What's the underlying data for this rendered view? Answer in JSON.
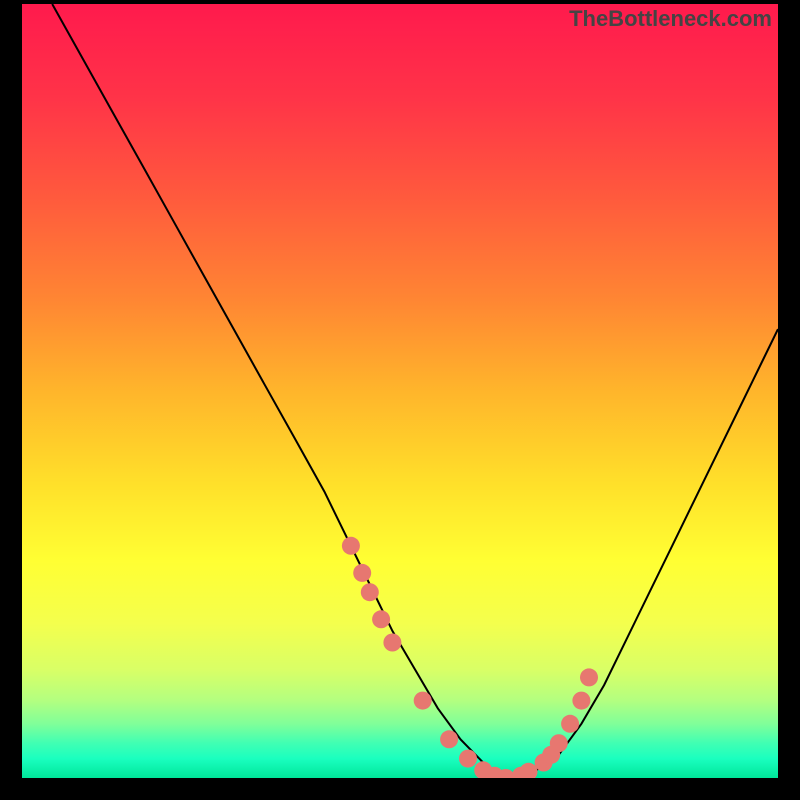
{
  "watermark": "TheBottleneck.com",
  "chart_data": {
    "type": "line",
    "title": "",
    "xlabel": "",
    "ylabel": "",
    "xlim": [
      0,
      100
    ],
    "ylim": [
      0,
      100
    ],
    "grid": false,
    "series": [
      {
        "name": "bottleneck-curve",
        "x": [
          4,
          8,
          12,
          16,
          20,
          24,
          28,
          32,
          36,
          40,
          43,
          46,
          49,
          52,
          55,
          58,
          60,
          62,
          64,
          66,
          68,
          71,
          74,
          77,
          80,
          83,
          86,
          89,
          92,
          95,
          98,
          100
        ],
        "y": [
          100,
          93,
          86,
          79,
          72,
          65,
          58,
          51,
          44,
          37,
          31,
          25,
          19,
          14,
          9,
          5,
          3,
          1,
          0,
          0,
          1,
          3,
          7,
          12,
          18,
          24,
          30,
          36,
          42,
          48,
          54,
          58
        ]
      }
    ],
    "markers": {
      "name": "highlight-dots",
      "color": "#e77770",
      "x": [
        43.5,
        45.0,
        46.0,
        47.5,
        49.0,
        53.0,
        56.5,
        59.0,
        61.0,
        62.5,
        64.0,
        66.0,
        67.0,
        69.0,
        70.0,
        71.0,
        72.5,
        74.0,
        75.0
      ],
      "y": [
        30.0,
        26.5,
        24.0,
        20.5,
        17.5,
        10.0,
        5.0,
        2.5,
        1.0,
        0.3,
        0.0,
        0.3,
        0.8,
        2.0,
        3.0,
        4.5,
        7.0,
        10.0,
        13.0
      ]
    },
    "gradient_stops": [
      {
        "offset": 0.0,
        "color": "#ff1a4d"
      },
      {
        "offset": 0.12,
        "color": "#ff3348"
      },
      {
        "offset": 0.25,
        "color": "#ff5a3d"
      },
      {
        "offset": 0.38,
        "color": "#ff8533"
      },
      {
        "offset": 0.5,
        "color": "#ffb52b"
      },
      {
        "offset": 0.62,
        "color": "#ffe02a"
      },
      {
        "offset": 0.72,
        "color": "#ffff33"
      },
      {
        "offset": 0.8,
        "color": "#f4ff4d"
      },
      {
        "offset": 0.86,
        "color": "#d9ff66"
      },
      {
        "offset": 0.9,
        "color": "#b3ff80"
      },
      {
        "offset": 0.93,
        "color": "#80ff99"
      },
      {
        "offset": 0.955,
        "color": "#40ffb3"
      },
      {
        "offset": 0.975,
        "color": "#1affbf"
      },
      {
        "offset": 1.0,
        "color": "#00e699"
      }
    ]
  }
}
